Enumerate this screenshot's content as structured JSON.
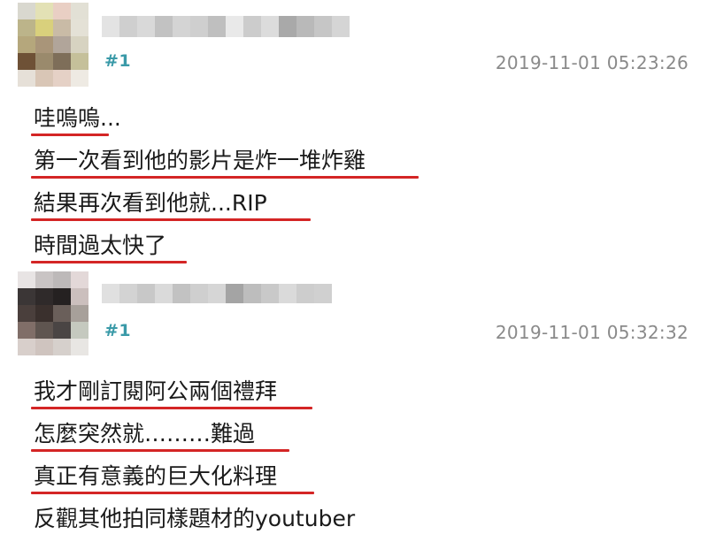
{
  "posts": [
    {
      "floor": "#1",
      "timestamp": "2019-11-01 05:23:26",
      "avatar_colors": [
        "#d9d8cf",
        "#e3e1b5",
        "#e9cfc4",
        "#e2e0d5",
        "#bcb48a",
        "#d9d07c",
        "#c9bba6",
        "#e4e1d6",
        "#b5a77c",
        "#a99579",
        "#b1a59a",
        "#d7d3c1",
        "#6e5136",
        "#9a8a6c",
        "#7e6e59",
        "#c5c09a",
        "#e6e0d8",
        "#d9c6b6",
        "#e5d1c6",
        "#eeeae3"
      ],
      "username_colors": [
        "#e3e3e3",
        "#cfcfcf",
        "#d9d9d9",
        "#c2c2c2",
        "#d4d4d4",
        "#cfcfcf",
        "#bfbfbf",
        "#e9e9e9",
        "#cccccc",
        "#dcdcdc",
        "#a9a9a9",
        "#b9b9b9",
        "#c6c6c6",
        "#d5d5d5"
      ],
      "lines": [
        {
          "text": "哇嗚嗚...",
          "underlined": true,
          "underline_width": 88
        },
        {
          "text": "第一次看到他的影片是炸一堆炸雞",
          "underlined": true,
          "underline_width": 438
        },
        {
          "text": "結果再次看到他就...RIP",
          "underlined": true,
          "underline_width": 316
        },
        {
          "text": "時間過太快了",
          "underlined": true,
          "underline_width": 176
        }
      ]
    },
    {
      "floor": "#1",
      "timestamp": "2019-11-01 05:32:32",
      "avatar_colors": [
        "#e8e4e4",
        "#c9c4c4",
        "#bdb9b9",
        "#e3d8d8",
        "#3b3636",
        "#2f2a2a",
        "#252121",
        "#cbbfbd",
        "#4a3f3c",
        "#3a302d",
        "#6a5f5a",
        "#a7a09a",
        "#806e68",
        "#5f5550",
        "#4a4544",
        "#c5c9bf",
        "#d8cfcb",
        "#cfc4bf",
        "#d6d0cc",
        "#e8e6e3"
      ],
      "username_colors": [
        "#e0e0e0",
        "#d3d3d3",
        "#c8c8c8",
        "#dadada",
        "#c2c2c2",
        "#cfcfcf",
        "#d6d6d6",
        "#a4a4a4",
        "#bdbdbd",
        "#c9c9c9",
        "#dadada",
        "#cdcdcd",
        "#d0d0d0"
      ],
      "lines": [
        {
          "text": "我才剛訂閱阿公兩個禮拜",
          "underlined": true,
          "underline_width": 318
        },
        {
          "text": "怎麼突然就………難過",
          "underlined": true,
          "underline_width": 292
        },
        {
          "text": "真正有意義的巨大化料理",
          "underlined": true,
          "underline_width": 320
        },
        {
          "text": "反觀其他拍同樣題材的youtuber",
          "underlined": false,
          "underline_width": 0
        }
      ]
    }
  ],
  "colors": {
    "floor": "#3a9aa8",
    "timestamp": "#8a8a8a",
    "underline": "#d42525",
    "text": "#1a1a1a"
  }
}
